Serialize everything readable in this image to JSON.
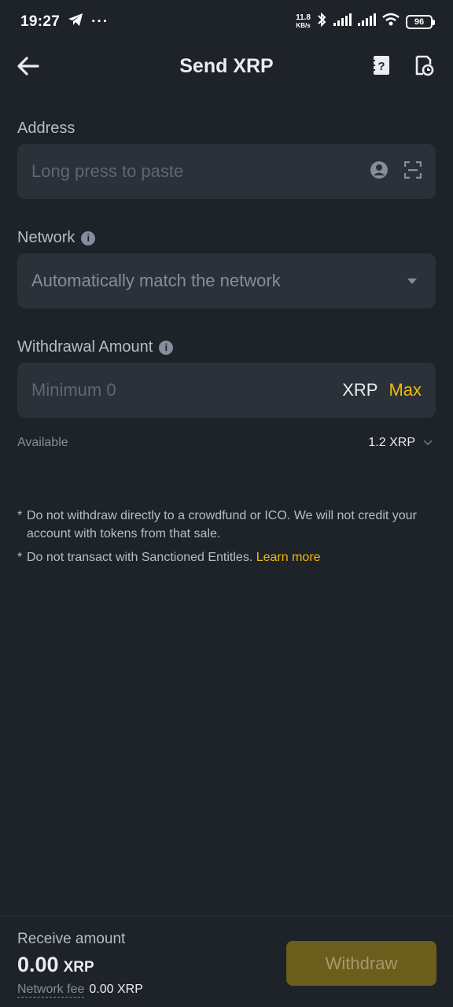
{
  "status_bar": {
    "time": "19:27",
    "net_speed_value": "11.8",
    "net_speed_unit": "KB/s",
    "battery": "96"
  },
  "header": {
    "title": "Send XRP"
  },
  "address": {
    "label": "Address",
    "placeholder": "Long press to paste"
  },
  "network": {
    "label": "Network",
    "value": "Automatically match the network"
  },
  "amount": {
    "label": "Withdrawal Amount",
    "placeholder": "Minimum 0",
    "unit": "XRP",
    "max_label": "Max"
  },
  "available": {
    "label": "Available",
    "value": "1.2 XRP"
  },
  "notes": {
    "note1": "Do not withdraw directly to a crowdfund or ICO. We will not credit your account with tokens from that sale.",
    "note2": "Do not transact with Sanctioned Entitles.",
    "learn_more": "Learn more"
  },
  "bottom": {
    "receive_label": "Receive amount",
    "receive_value": "0.00",
    "receive_unit": "XRP",
    "fee_label": "Network fee",
    "fee_value": "0.00 XRP",
    "withdraw_label": "Withdraw"
  },
  "colors": {
    "background": "#1e2329",
    "field": "#2b3139",
    "accent": "#f0b90b",
    "withdraw_disabled": "#6b5d1c"
  }
}
